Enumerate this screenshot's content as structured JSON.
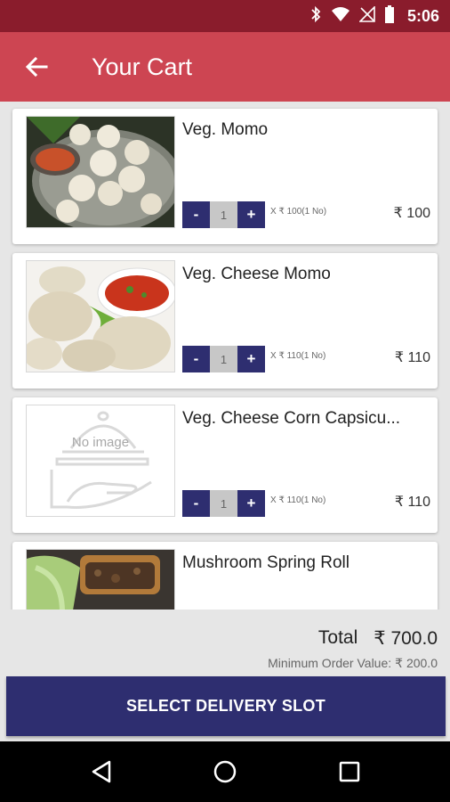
{
  "status_bar": {
    "time": "5:06",
    "icons": [
      "bluetooth-icon",
      "wifi-icon",
      "no-signal-icon",
      "battery-icon"
    ]
  },
  "app_bar": {
    "title": "Your Cart",
    "back_icon": "arrow-left-icon"
  },
  "cart_items": [
    {
      "name": "Veg. Momo",
      "quantity": "1",
      "unit_price": "X ₹ 100(1 No)",
      "price": "₹ 100",
      "image": "momo-photo"
    },
    {
      "name": "Veg. Cheese Momo",
      "quantity": "1",
      "unit_price": "X ₹ 110(1 No)",
      "price": "₹ 110",
      "image": "cheese-momo-photo"
    },
    {
      "name": "Veg. Cheese Corn Capsicu...",
      "quantity": "1",
      "unit_price": "X ₹ 110(1 No)",
      "price": "₹ 110",
      "image": "no-image-placeholder",
      "image_text": "No image"
    },
    {
      "name": "Mushroom Spring Roll",
      "image": "spring-roll-photo"
    }
  ],
  "stepper": {
    "minus": "-",
    "plus": "+"
  },
  "summary": {
    "total_label": "Total",
    "total_value": "₹ 700.0",
    "min_order_label": "Minimum Order Value:",
    "min_order_value": "₹ 200.0"
  },
  "primary_action": {
    "label": "SELECT DELIVERY SLOT"
  },
  "colors": {
    "status_bar": "#8a1c2c",
    "app_bar": "#cd4552",
    "accent": "#2e2e70",
    "background": "#e6e6e6"
  },
  "nav_bar": {
    "icons": [
      "back-triangle-icon",
      "home-circle-icon",
      "recents-square-icon"
    ]
  }
}
